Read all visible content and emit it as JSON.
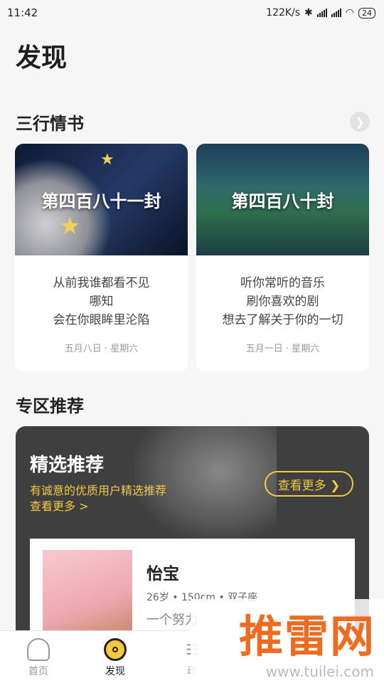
{
  "status_bar": {
    "time": "11:42",
    "network_speed": "122K/s",
    "battery": "24"
  },
  "page_title": "发现",
  "love_letters": {
    "title": "三行情书",
    "more_icon": "chevron-right-icon",
    "cards": [
      {
        "image_title": "第四百八十一封",
        "lines": [
          "从前我谁都看不见",
          "哪知",
          "会在你眼眸里沦陷"
        ],
        "date": "五月八日 · 星期六"
      },
      {
        "image_title": "第四百八十封",
        "lines": [
          "听你常听的音乐",
          "刷你喜欢的剧",
          "想去了解关于你的一切"
        ],
        "date": "五月一日 · 星期六"
      }
    ]
  },
  "zone": {
    "title": "专区推荐",
    "featured": {
      "title": "精选推荐",
      "subtitle_line1": "有诚意的优质用户精选推荐",
      "subtitle_line2": "查看更多 >",
      "button": "查看更多 ❯"
    },
    "profile": {
      "name": "怡宝",
      "meta": "26岁 • 150cm • 双子座",
      "desc": "一个努力"
    }
  },
  "tabs": [
    {
      "label": "首页",
      "icon": "home-icon"
    },
    {
      "label": "发现",
      "icon": "discover-icon"
    },
    {
      "label": "动",
      "icon": "moments-icon"
    }
  ],
  "watermark": {
    "brand": "推雷网",
    "url": "www.tuilei.com"
  },
  "colors": {
    "accent": "#f3c843",
    "background": "#f6f6f6",
    "featured_bg": "#3f3f3f",
    "watermark": "#ef6b1f"
  }
}
